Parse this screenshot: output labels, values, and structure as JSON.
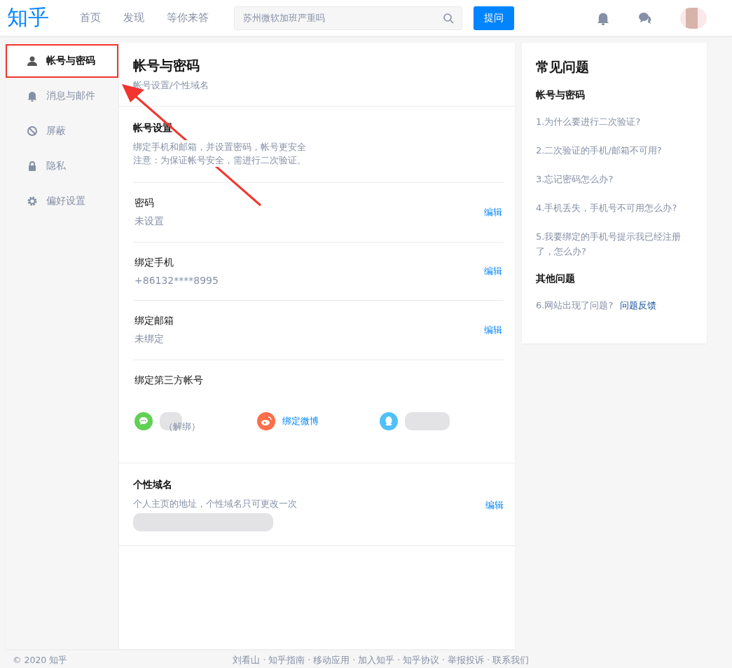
{
  "header": {
    "logo": "知乎",
    "nav": [
      {
        "label": "首页",
        "selected": false
      },
      {
        "label": "发现",
        "selected": false
      },
      {
        "label": "等你来答",
        "selected": false
      }
    ],
    "search": {
      "placeholder": "苏州微软加班严重吗"
    },
    "ask_button": "提问"
  },
  "sidebar": {
    "items": [
      {
        "label": "帐号与密码",
        "kind": "user",
        "selected": true,
        "annotated": true
      },
      {
        "label": "消息与邮件",
        "kind": "bell",
        "selected": false,
        "annotated": false
      },
      {
        "label": "屏蔽",
        "kind": "ban",
        "selected": false,
        "annotated": false
      },
      {
        "label": "隐私",
        "kind": "lock",
        "selected": false,
        "annotated": false
      },
      {
        "label": "偏好设置",
        "kind": "gear",
        "selected": false,
        "annotated": false
      }
    ]
  },
  "main": {
    "title": "帐号与密码",
    "subtitle": "帐号设置/个性域名",
    "account_settings": {
      "title": "帐号设置",
      "notes": [
        "绑定手机和邮箱，并设置密码，帐号更安全",
        "注意：为保证帐号安全，需进行二次验证。"
      ]
    },
    "rows": [
      {
        "label": "密码",
        "value": "未设置",
        "action": "编辑"
      },
      {
        "label": "绑定手机",
        "value": "+86132****8995",
        "action": "编辑"
      },
      {
        "label": "绑定邮箱",
        "value": "未绑定",
        "action": "编辑"
      }
    ],
    "third_party": {
      "title": "绑定第三方帐号",
      "accounts": [
        {
          "kind": "wechat",
          "label": "（解绑）"
        },
        {
          "kind": "weibo",
          "label": "绑定微博"
        },
        {
          "kind": "qq"
        }
      ]
    },
    "domain": {
      "title": "个性域名",
      "note": "个人主页的地址，个性域名只可更改一次",
      "action": "编辑"
    }
  },
  "faq": {
    "title": "常见问题",
    "groups": [
      {
        "title": "帐号与密码",
        "items": [
          {
            "text": "1.为什么要进行二次验证?"
          },
          {
            "text": "2.二次验证的手机/邮箱不可用?"
          },
          {
            "text": "3.忘记密码怎么办?"
          },
          {
            "text": "4.手机丢失，手机号不可用怎么办?"
          },
          {
            "text": "5.我要绑定的手机号提示我已经注册了，怎么办?"
          }
        ]
      },
      {
        "title": "其他问题",
        "items": [
          {
            "text": "6.网站出现了问题?",
            "link": "问题反馈"
          }
        ]
      }
    ]
  },
  "footer": {
    "copyright": "© 2020 知乎",
    "links": "刘看山 · 知乎指南 · 移动应用 · 加入知乎 · 知乎协议 · 举报投诉 · 联系我们"
  }
}
